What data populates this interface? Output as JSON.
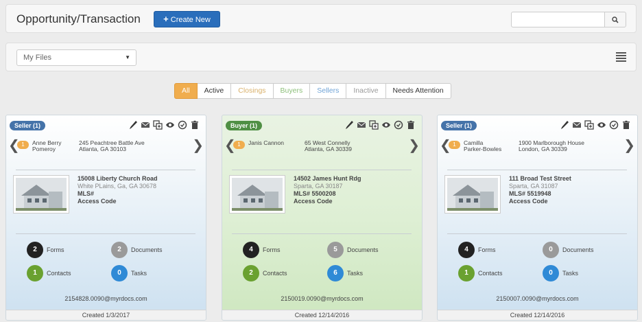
{
  "header": {
    "title": "Opportunity/Transaction",
    "create_label": "Create New",
    "search_placeholder": ""
  },
  "filter": {
    "selected": "My Files"
  },
  "tabs": [
    {
      "label": "All",
      "color": "#f0ad4e",
      "active": true
    },
    {
      "label": "Active",
      "color": "#333333"
    },
    {
      "label": "Closings",
      "color": "#d9b06a"
    },
    {
      "label": "Buyers",
      "color": "#8cbf79"
    },
    {
      "label": "Sellers",
      "color": "#6fa3d6"
    },
    {
      "label": "Inactive",
      "color": "#999999"
    },
    {
      "label": "Needs Attention",
      "color": "#333333"
    }
  ],
  "cards": [
    {
      "badge": "Seller (1)",
      "badge_color": "#4573a9",
      "contact_count": "1",
      "contact_name_1": "Anne Berry",
      "contact_name_2": "Pomeroy",
      "contact_addr_1": "245 Peachtree Battle Ave",
      "contact_addr_2": "Atlanta, GA 30103",
      "street": "15008 Liberty Church Road",
      "city": "White PLains, Ga, GA 30678",
      "mls": "MLS#",
      "access": "Access Code",
      "forms": "2",
      "forms_label": "Forms",
      "documents": "2",
      "documents_label": "Documents",
      "contacts": "1",
      "contacts_label": "Contacts",
      "tasks": "0",
      "tasks_label": "Tasks",
      "email": "2154828.0090@myrdocs.com",
      "created": "Created 1/3/2017"
    },
    {
      "badge": "Buyer (1)",
      "badge_color": "#4f8f44",
      "contact_count": "1",
      "contact_name_1": "Janis Cannon",
      "contact_name_2": "",
      "contact_addr_1": "65 West Connelly",
      "contact_addr_2": "Atlanta, GA 30339",
      "street": "14502 James Hunt Rdg",
      "city": "Sparta, GA 30187",
      "mls": "MLS# 5500208",
      "access": "Access Code",
      "forms": "4",
      "forms_label": "Forms",
      "documents": "5",
      "documents_label": "Documents",
      "contacts": "2",
      "contacts_label": "Contacts",
      "tasks": "6",
      "tasks_label": "Tasks",
      "email": "2150019.0090@myrdocs.com",
      "created": "Created 12/14/2016"
    },
    {
      "badge": "Seller (1)",
      "badge_color": "#4573a9",
      "contact_count": "1",
      "contact_name_1": "Camilla",
      "contact_name_2": "Parker-Bowles",
      "contact_addr_1": "1900 Marlborough House",
      "contact_addr_2": "London, GA 30339",
      "street": "111 Broad Test Street",
      "city": "Sparta, GA 31087",
      "mls": "MLS# 5519948",
      "access": "Access Code",
      "forms": "4",
      "forms_label": "Forms",
      "documents": "0",
      "documents_label": "Documents",
      "contacts": "1",
      "contacts_label": "Contacts",
      "tasks": "0",
      "tasks_label": "Tasks",
      "email": "2150007.0090@myrdocs.com",
      "created": "Created 12/14/2016"
    }
  ]
}
